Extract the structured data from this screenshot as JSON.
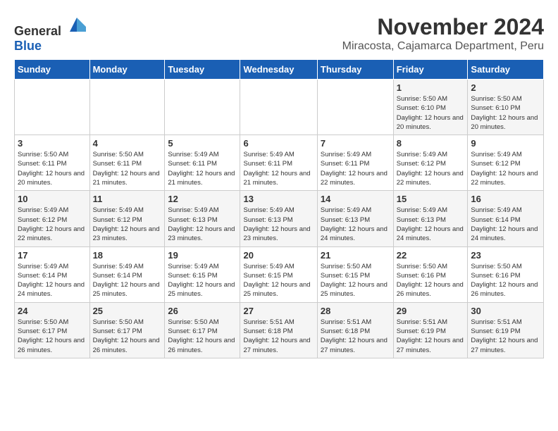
{
  "logo": {
    "general": "General",
    "blue": "Blue"
  },
  "title": "November 2024",
  "subtitle": "Miracosta, Cajamarca Department, Peru",
  "weekdays": [
    "Sunday",
    "Monday",
    "Tuesday",
    "Wednesday",
    "Thursday",
    "Friday",
    "Saturday"
  ],
  "weeks": [
    [
      {
        "day": "",
        "info": ""
      },
      {
        "day": "",
        "info": ""
      },
      {
        "day": "",
        "info": ""
      },
      {
        "day": "",
        "info": ""
      },
      {
        "day": "",
        "info": ""
      },
      {
        "day": "1",
        "info": "Sunrise: 5:50 AM\nSunset: 6:10 PM\nDaylight: 12 hours and 20 minutes."
      },
      {
        "day": "2",
        "info": "Sunrise: 5:50 AM\nSunset: 6:10 PM\nDaylight: 12 hours and 20 minutes."
      }
    ],
    [
      {
        "day": "3",
        "info": "Sunrise: 5:50 AM\nSunset: 6:11 PM\nDaylight: 12 hours and 20 minutes."
      },
      {
        "day": "4",
        "info": "Sunrise: 5:50 AM\nSunset: 6:11 PM\nDaylight: 12 hours and 21 minutes."
      },
      {
        "day": "5",
        "info": "Sunrise: 5:49 AM\nSunset: 6:11 PM\nDaylight: 12 hours and 21 minutes."
      },
      {
        "day": "6",
        "info": "Sunrise: 5:49 AM\nSunset: 6:11 PM\nDaylight: 12 hours and 21 minutes."
      },
      {
        "day": "7",
        "info": "Sunrise: 5:49 AM\nSunset: 6:11 PM\nDaylight: 12 hours and 22 minutes."
      },
      {
        "day": "8",
        "info": "Sunrise: 5:49 AM\nSunset: 6:12 PM\nDaylight: 12 hours and 22 minutes."
      },
      {
        "day": "9",
        "info": "Sunrise: 5:49 AM\nSunset: 6:12 PM\nDaylight: 12 hours and 22 minutes."
      }
    ],
    [
      {
        "day": "10",
        "info": "Sunrise: 5:49 AM\nSunset: 6:12 PM\nDaylight: 12 hours and 22 minutes."
      },
      {
        "day": "11",
        "info": "Sunrise: 5:49 AM\nSunset: 6:12 PM\nDaylight: 12 hours and 23 minutes."
      },
      {
        "day": "12",
        "info": "Sunrise: 5:49 AM\nSunset: 6:13 PM\nDaylight: 12 hours and 23 minutes."
      },
      {
        "day": "13",
        "info": "Sunrise: 5:49 AM\nSunset: 6:13 PM\nDaylight: 12 hours and 23 minutes."
      },
      {
        "day": "14",
        "info": "Sunrise: 5:49 AM\nSunset: 6:13 PM\nDaylight: 12 hours and 24 minutes."
      },
      {
        "day": "15",
        "info": "Sunrise: 5:49 AM\nSunset: 6:13 PM\nDaylight: 12 hours and 24 minutes."
      },
      {
        "day": "16",
        "info": "Sunrise: 5:49 AM\nSunset: 6:14 PM\nDaylight: 12 hours and 24 minutes."
      }
    ],
    [
      {
        "day": "17",
        "info": "Sunrise: 5:49 AM\nSunset: 6:14 PM\nDaylight: 12 hours and 24 minutes."
      },
      {
        "day": "18",
        "info": "Sunrise: 5:49 AM\nSunset: 6:14 PM\nDaylight: 12 hours and 25 minutes."
      },
      {
        "day": "19",
        "info": "Sunrise: 5:49 AM\nSunset: 6:15 PM\nDaylight: 12 hours and 25 minutes."
      },
      {
        "day": "20",
        "info": "Sunrise: 5:49 AM\nSunset: 6:15 PM\nDaylight: 12 hours and 25 minutes."
      },
      {
        "day": "21",
        "info": "Sunrise: 5:50 AM\nSunset: 6:15 PM\nDaylight: 12 hours and 25 minutes."
      },
      {
        "day": "22",
        "info": "Sunrise: 5:50 AM\nSunset: 6:16 PM\nDaylight: 12 hours and 26 minutes."
      },
      {
        "day": "23",
        "info": "Sunrise: 5:50 AM\nSunset: 6:16 PM\nDaylight: 12 hours and 26 minutes."
      }
    ],
    [
      {
        "day": "24",
        "info": "Sunrise: 5:50 AM\nSunset: 6:17 PM\nDaylight: 12 hours and 26 minutes."
      },
      {
        "day": "25",
        "info": "Sunrise: 5:50 AM\nSunset: 6:17 PM\nDaylight: 12 hours and 26 minutes."
      },
      {
        "day": "26",
        "info": "Sunrise: 5:50 AM\nSunset: 6:17 PM\nDaylight: 12 hours and 26 minutes."
      },
      {
        "day": "27",
        "info": "Sunrise: 5:51 AM\nSunset: 6:18 PM\nDaylight: 12 hours and 27 minutes."
      },
      {
        "day": "28",
        "info": "Sunrise: 5:51 AM\nSunset: 6:18 PM\nDaylight: 12 hours and 27 minutes."
      },
      {
        "day": "29",
        "info": "Sunrise: 5:51 AM\nSunset: 6:19 PM\nDaylight: 12 hours and 27 minutes."
      },
      {
        "day": "30",
        "info": "Sunrise: 5:51 AM\nSunset: 6:19 PM\nDaylight: 12 hours and 27 minutes."
      }
    ]
  ]
}
